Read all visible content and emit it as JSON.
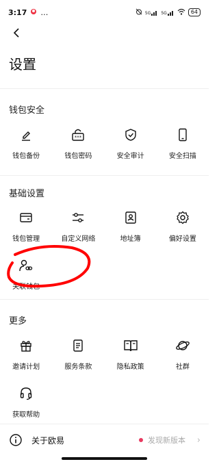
{
  "status_bar": {
    "time": "3:17",
    "extra": "…",
    "network1": "5G",
    "network2": "5G",
    "battery": "64"
  },
  "header": {
    "title": "设置"
  },
  "sections": {
    "wallet_security": {
      "title": "钱包安全",
      "items": [
        {
          "label": "钱包备份",
          "icon": "pencil-icon"
        },
        {
          "label": "钱包密码",
          "icon": "password-lock-icon"
        },
        {
          "label": "安全审计",
          "icon": "shield-check-icon"
        },
        {
          "label": "安全扫描",
          "icon": "phone-icon"
        }
      ]
    },
    "basic": {
      "title": "基础设置",
      "items": [
        {
          "label": "钱包管理",
          "icon": "wallet-icon"
        },
        {
          "label": "自定义网络",
          "icon": "sliders-icon"
        },
        {
          "label": "地址簿",
          "icon": "contact-book-icon"
        },
        {
          "label": "偏好设置",
          "icon": "gear-icon"
        },
        {
          "label": "关联钱包",
          "icon": "user-link-icon"
        }
      ]
    },
    "more": {
      "title": "更多",
      "items": [
        {
          "label": "邀请计划",
          "icon": "gift-icon"
        },
        {
          "label": "服务条款",
          "icon": "document-icon"
        },
        {
          "label": "隐私政策",
          "icon": "book-icon"
        },
        {
          "label": "社群",
          "icon": "planet-icon"
        },
        {
          "label": "获取帮助",
          "icon": "headset-icon"
        }
      ]
    }
  },
  "about": {
    "label": "关于欧易",
    "update_text": "发现新版本"
  },
  "colors": {
    "annotation": "#ff0000",
    "update_dot": "#e8395f"
  }
}
